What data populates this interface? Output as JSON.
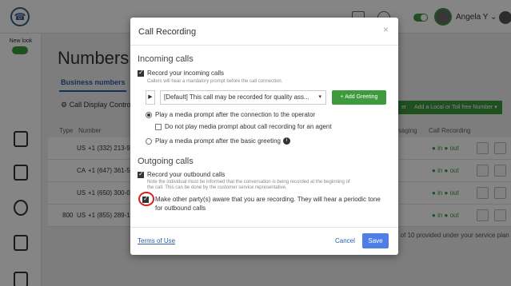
{
  "topbar": {
    "user_name": "Angela Y",
    "user_caret": "⌄"
  },
  "leftnav": {
    "new_look_label": "New look"
  },
  "background": {
    "page_title": "Numbers &",
    "tab_business_numbers": "Business numbers",
    "call_display_control": "Call Display Control",
    "partial_button_label": "er",
    "add_number_button": "Add a Local or Toll free Number ▾",
    "columns": {
      "type": "Type",
      "number": "Number",
      "messaging": "ssaging",
      "call_recording": "Call Recording"
    },
    "rows": [
      {
        "type": "",
        "flag": "US",
        "number": "+1 (332) 213-92",
        "in": "in",
        "out": "out"
      },
      {
        "type": "",
        "flag": "CA",
        "number": "+1 (647) 361-5",
        "in": "in",
        "out": "out"
      },
      {
        "type": "",
        "flag": "US",
        "number": "+1 (650) 300-0",
        "in": "in",
        "out": "out"
      },
      {
        "type": "800",
        "flag": "US",
        "number": "+1 (855) 289-1",
        "in": "in",
        "out": "out"
      }
    ],
    "footnote": "d of 10 provided under your service plan"
  },
  "modal": {
    "title": "Call Recording",
    "close_glyph": "×",
    "incoming": {
      "heading": "Incoming calls",
      "record_label": "Record your incoming calls",
      "record_checked": true,
      "record_hint": "Callers will hear a mandatory prompt before the call connection.",
      "play_glyph": "▶",
      "greeting_select": "[Default] This call may be recorded for quality ass...",
      "add_greeting_label": "+ Add Greeting",
      "option_after_connection": "Play a media prompt after the connection to the operator",
      "option_after_connection_selected": true,
      "no_prompt_agent_label": "Do not play media prompt about call recording for an agent",
      "no_prompt_agent_checked": false,
      "option_after_greeting": "Play a media prompt after the basic greeting",
      "option_after_greeting_selected": false,
      "info_glyph": "i"
    },
    "outgoing": {
      "heading": "Outgoing calls",
      "record_label": "Record your outbound calls",
      "record_checked": true,
      "record_hint_line1": "Note the individual must be informed that the conversation is being recorded at the beginning of",
      "record_hint_line2": "the call. This can be done by the customer service representative.",
      "aware_label_line1": "Make other party(s) aware that you are recording. They will hear a periodic tone",
      "aware_label_line2": "for outbound calls",
      "aware_checked": true
    },
    "footer": {
      "terms_label": "Terms of Use",
      "cancel_label": "Cancel",
      "save_label": "Save"
    }
  },
  "colors": {
    "accent_green": "#3d9a3d",
    "link_blue": "#2a5ca8",
    "save_blue": "#4e7ee6",
    "highlight_red": "#d32020"
  }
}
